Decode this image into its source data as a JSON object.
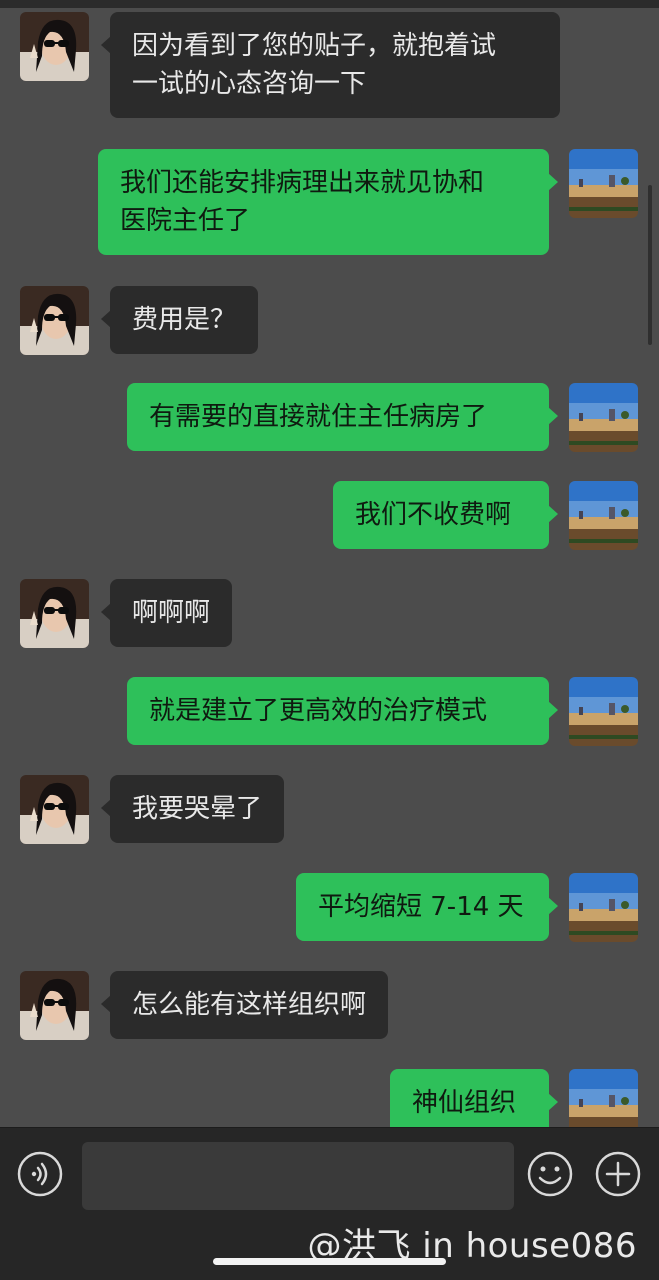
{
  "conversation": {
    "messages": [
      {
        "side": "in",
        "lines": [
          "因为看到了您的贴子，就抱着试",
          "一试的心态咨询一下"
        ]
      },
      {
        "side": "out",
        "lines": [
          "我们还能安排病理出来就见协和",
          "医院主任了"
        ]
      },
      {
        "side": "in",
        "lines": [
          "费用是？"
        ]
      },
      {
        "side": "out",
        "lines": [
          "有需要的直接就住主任病房了"
        ]
      },
      {
        "side": "out",
        "lines": [
          "我们不收费啊"
        ]
      },
      {
        "side": "in",
        "lines": [
          "啊啊啊"
        ]
      },
      {
        "side": "out",
        "lines": [
          "就是建立了更高效的治疗模式"
        ]
      },
      {
        "side": "in",
        "lines": [
          "我要哭晕了"
        ]
      },
      {
        "side": "out",
        "lines": [
          "平均缩短 7-14 天"
        ]
      },
      {
        "side": "in",
        "lines": [
          "怎么能有这样组织啊"
        ]
      },
      {
        "side": "out",
        "lines": [
          "神仙组织"
        ]
      }
    ]
  },
  "input_bar": {
    "voice_icon": "voice-wave-icon",
    "emoji_icon": "smiley-icon",
    "plus_icon": "plus-circle-icon",
    "input_value": ""
  },
  "watermark": "@洪飞 in house086",
  "colors": {
    "incoming_bubble": "#2b2b2b",
    "outgoing_bubble": "#2ec05a",
    "background": "#4c4c4c"
  }
}
